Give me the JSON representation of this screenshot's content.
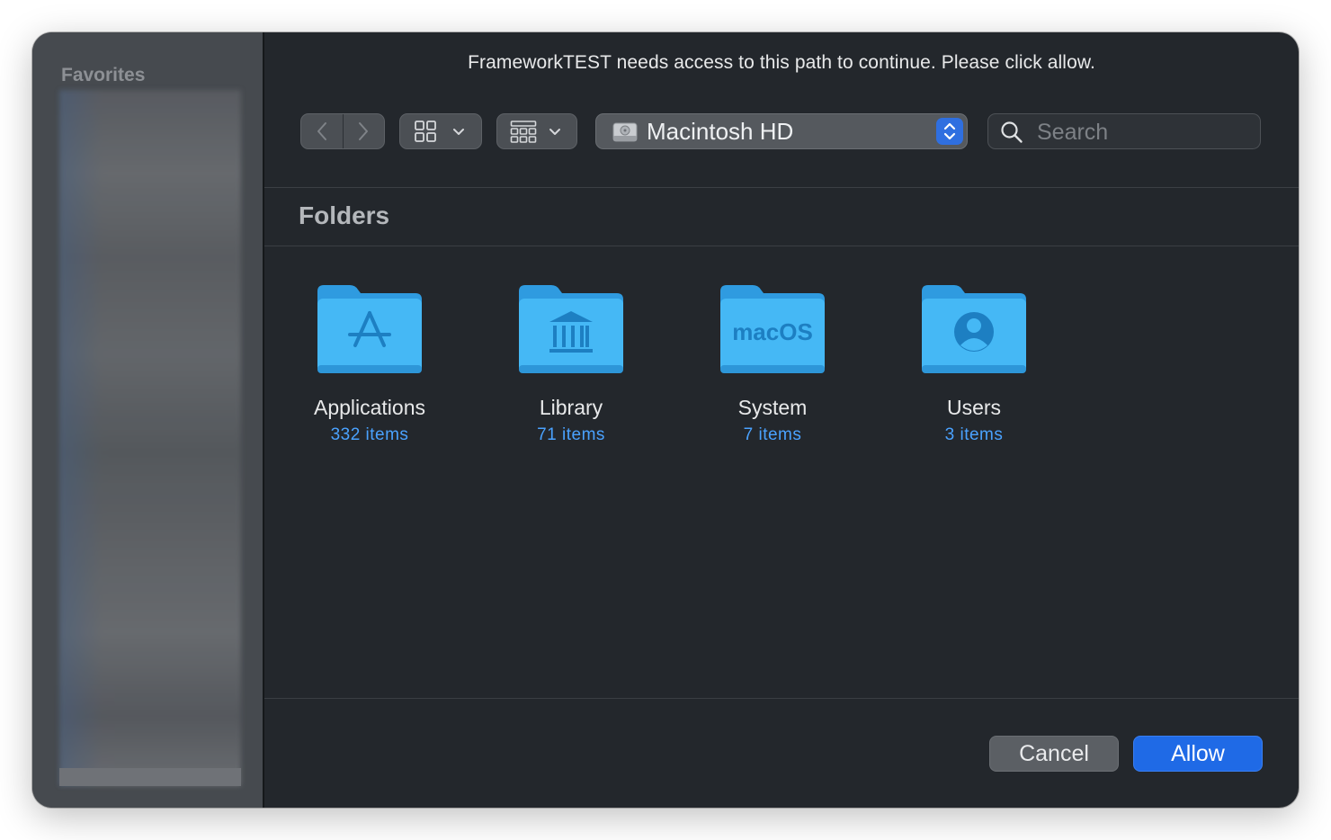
{
  "sidebar": {
    "title": "Favorites"
  },
  "dialog": {
    "message": "FrameworkTEST needs access to this path to continue. Please click allow."
  },
  "toolbar": {
    "back_icon": "chevron-left-icon",
    "forward_icon": "chevron-right-icon",
    "view_icon": "grid-icon",
    "group_icon": "grouping-grid-icon",
    "location": "Macintosh HD",
    "search_placeholder": "Search"
  },
  "content": {
    "section_title": "Folders",
    "folders": [
      {
        "name": "Applications",
        "count": "332 items",
        "badge": "app-store-icon"
      },
      {
        "name": "Library",
        "count": "71 items",
        "badge": "library-building-icon"
      },
      {
        "name": "System",
        "count": "7 items",
        "badge": "macOS"
      },
      {
        "name": "Users",
        "count": "3 items",
        "badge": "user-icon"
      }
    ]
  },
  "buttons": {
    "cancel": "Cancel",
    "allow": "Allow"
  },
  "colors": {
    "window_bg": "#23272c",
    "sidebar_bg": "#464a4f",
    "accent": "#1f6ae6",
    "folder_blue": "#3cb0f0",
    "link_blue": "#4aa2ff"
  }
}
